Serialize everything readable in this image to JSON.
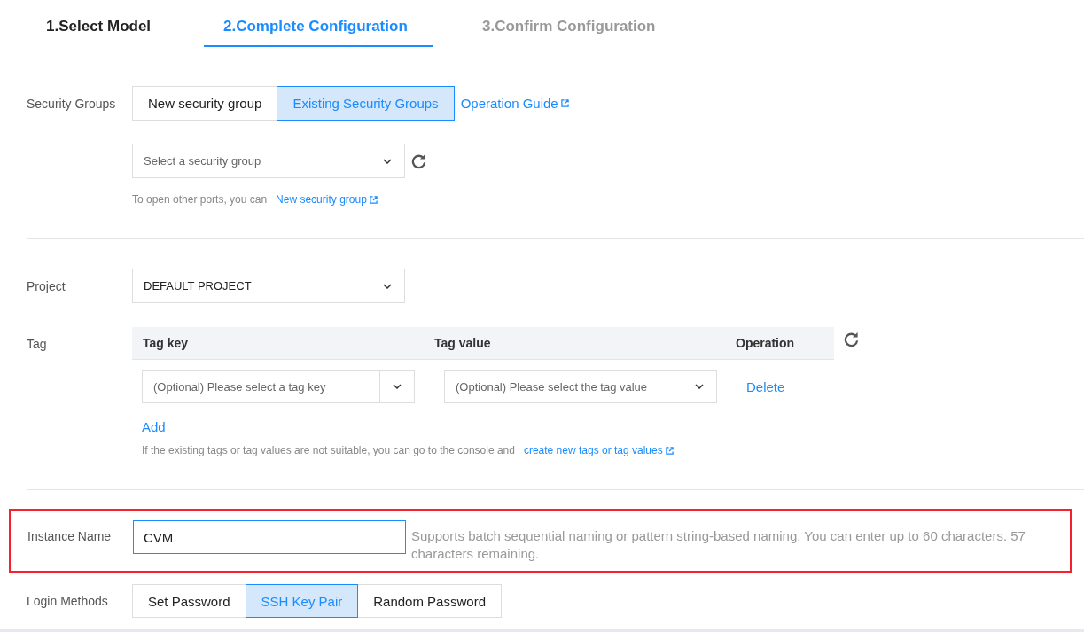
{
  "steps": [
    {
      "label": "1.Select Model",
      "selected": false,
      "completed": true
    },
    {
      "label": "2.Complete Configuration",
      "selected": true,
      "completed": false
    },
    {
      "label": "3.Confirm Configuration",
      "selected": false,
      "completed": false
    }
  ],
  "security_groups": {
    "label": "Security Groups",
    "options": [
      {
        "label": "New security group",
        "selected": false
      },
      {
        "label": "Existing Security Groups",
        "selected": true
      }
    ],
    "guide_link": "Operation Guide",
    "select": {
      "placeholder": "Select a security group"
    },
    "hint": "To open other ports, you can",
    "hint_link": "New security group"
  },
  "project": {
    "label": "Project",
    "value": "DEFAULT PROJECT"
  },
  "tag": {
    "label": "Tag",
    "columns": [
      "Tag key",
      "Tag value",
      "Operation"
    ],
    "rows": [
      {
        "key_placeholder": "(Optional) Please select a tag key",
        "value_placeholder": "(Optional) Please select the tag value",
        "action": "Delete"
      }
    ],
    "add": "Add",
    "hint": "If the existing tags or tag values are not suitable, you can go to the console and",
    "hint_link": "create new tags or tag values"
  },
  "instance_name": {
    "label": "Instance Name",
    "value": "CVM",
    "highlighted": true,
    "hint": "Supports batch sequential naming or pattern string-based naming. You can enter up to 60 characters. 57 characters remaining."
  },
  "login_methods": {
    "label": "Login Methods",
    "options": [
      {
        "label": "Set Password",
        "selected": false
      },
      {
        "label": "SSH Key Pair",
        "selected": true
      },
      {
        "label": "Random Password",
        "selected": false
      }
    ]
  }
}
